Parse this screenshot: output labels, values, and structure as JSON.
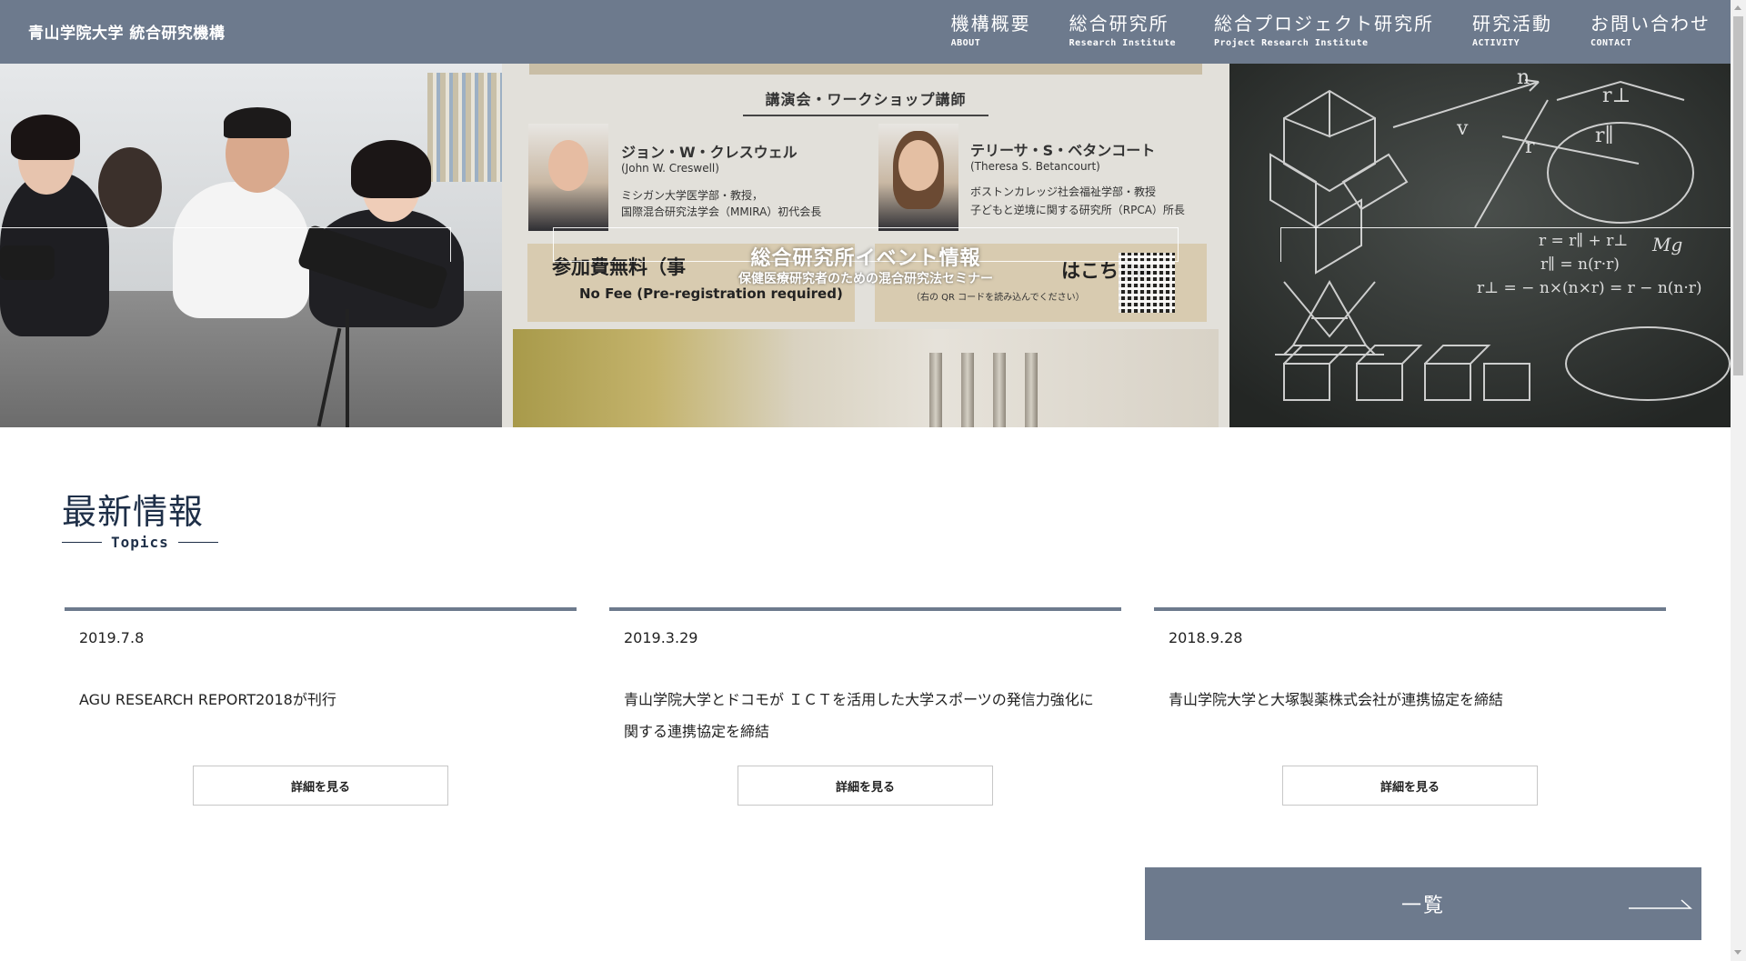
{
  "header": {
    "logo": "青山学院大学 統合研究機構",
    "nav": [
      {
        "jp": "機構概要",
        "en": "ABOUT"
      },
      {
        "jp": "総合研究所",
        "en": "Research Institute"
      },
      {
        "jp": "総合プロジェクト研究所",
        "en": "Project Research Institute"
      },
      {
        "jp": "研究活動",
        "en": "ACTIVITY"
      },
      {
        "jp": "お問い合わせ",
        "en": "CONTACT"
      }
    ]
  },
  "hero": {
    "title": "総合研究所イベント情報",
    "subtitle": "保健医療研究者のための混合研究法セミナー",
    "flyer": {
      "heading": "講演会・ワークショップ講師",
      "speaker1_name": "ジョン・W・クレスウェル",
      "speaker1_en": "(John W. Creswell)",
      "speaker1_desc1": "ミシガン大学医学部・教授，",
      "speaker1_desc2": "国際混合研究法学会（MMIRA）初代会長",
      "speaker2_name": "テリーサ・S・ベタンコート",
      "speaker2_en": "(Theresa S. Betancourt)",
      "speaker2_desc1": "ボストンカレッジ社会福祉学部・教授",
      "speaker2_desc2": "子どもと逆境に関する研究所（RPCA）所長",
      "fee_jp": "参加費無料（事",
      "fee_en": "No Fee (Pre-registration required)",
      "register_jp": "はこちら▶",
      "register_note": "（右の QR コードを読み込んでください）"
    },
    "chalk_formulas": [
      "r = r∥ + r⊥",
      "r∥ = n(r·r)",
      "r⊥ = − n×(n×r) = r − n(n·r)",
      "Mg",
      "v",
      "r",
      "n",
      "r∥",
      "r⊥"
    ]
  },
  "topics": {
    "title": "最新情報",
    "subtitle": "Topics",
    "items": [
      {
        "date": "2019.7.8",
        "title": "AGU RESEARCH REPORT2018が刊行",
        "button": "詳細を見る"
      },
      {
        "date": "2019.3.29",
        "title": "青山学院大学とドコモが ＩＣＴを活用した大学スポーツの発信力強化に関する連携協定を締結",
        "button": "詳細を見る"
      },
      {
        "date": "2018.9.28",
        "title": "青山学院大学と大塚製薬株式会社が連携協定を締結",
        "button": "詳細を見る"
      }
    ],
    "more_label": "一覧"
  },
  "colors": {
    "header_bg": "#6d7a8d",
    "title_navy": "#1e2f48",
    "card_border": "#6d7a8d"
  }
}
